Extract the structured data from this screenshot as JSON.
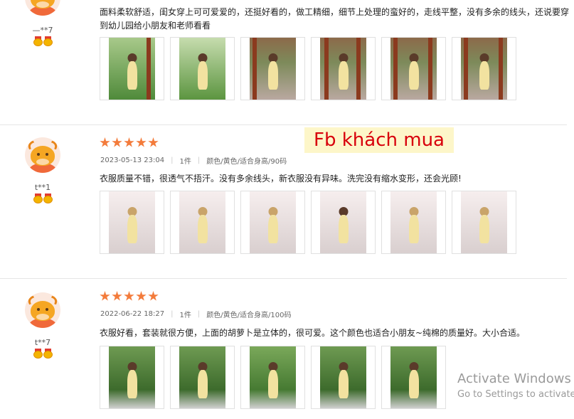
{
  "reviews": [
    {
      "username": "—**7",
      "comment": "面料柔软舒适，闺女穿上可可爱爱的，还挺好看的，做工精细，细节上处理的蛮好的，走线平整，没有多余的线头，还说要穿到幼儿园给小朋友和老师看看",
      "photo_count": 6
    },
    {
      "username": "t**1",
      "rating": 5,
      "date": "2023-05-13 23:04",
      "quantity": "1件",
      "variant": "颜色/黄色/适合身高/90码",
      "comment": "衣服质量不错，很透气不捂汗。没有多余线头，新衣服没有异味。洗完没有缩水变形，还会光顾!",
      "photo_count": 6
    },
    {
      "username": "t**7",
      "rating": 5,
      "date": "2022-06-22 18:27",
      "quantity": "1件",
      "variant": "颜色/黄色/适合身高/100码",
      "comment": "衣服好看，套装就很方便，上面的胡萝卜是立体的，很可爱。这个颜色也适合小朋友~纯棉的质量好。大小合适。",
      "photo_count": 5
    }
  ],
  "overlay_label": "Fb khách mua",
  "watermark": {
    "line1": "Activate Windows",
    "line2": "Go to Settings to activate"
  },
  "colors": {
    "star": "#f37b3b",
    "overlay_text": "#d8000c",
    "overlay_bg": "#fdf6c9"
  }
}
